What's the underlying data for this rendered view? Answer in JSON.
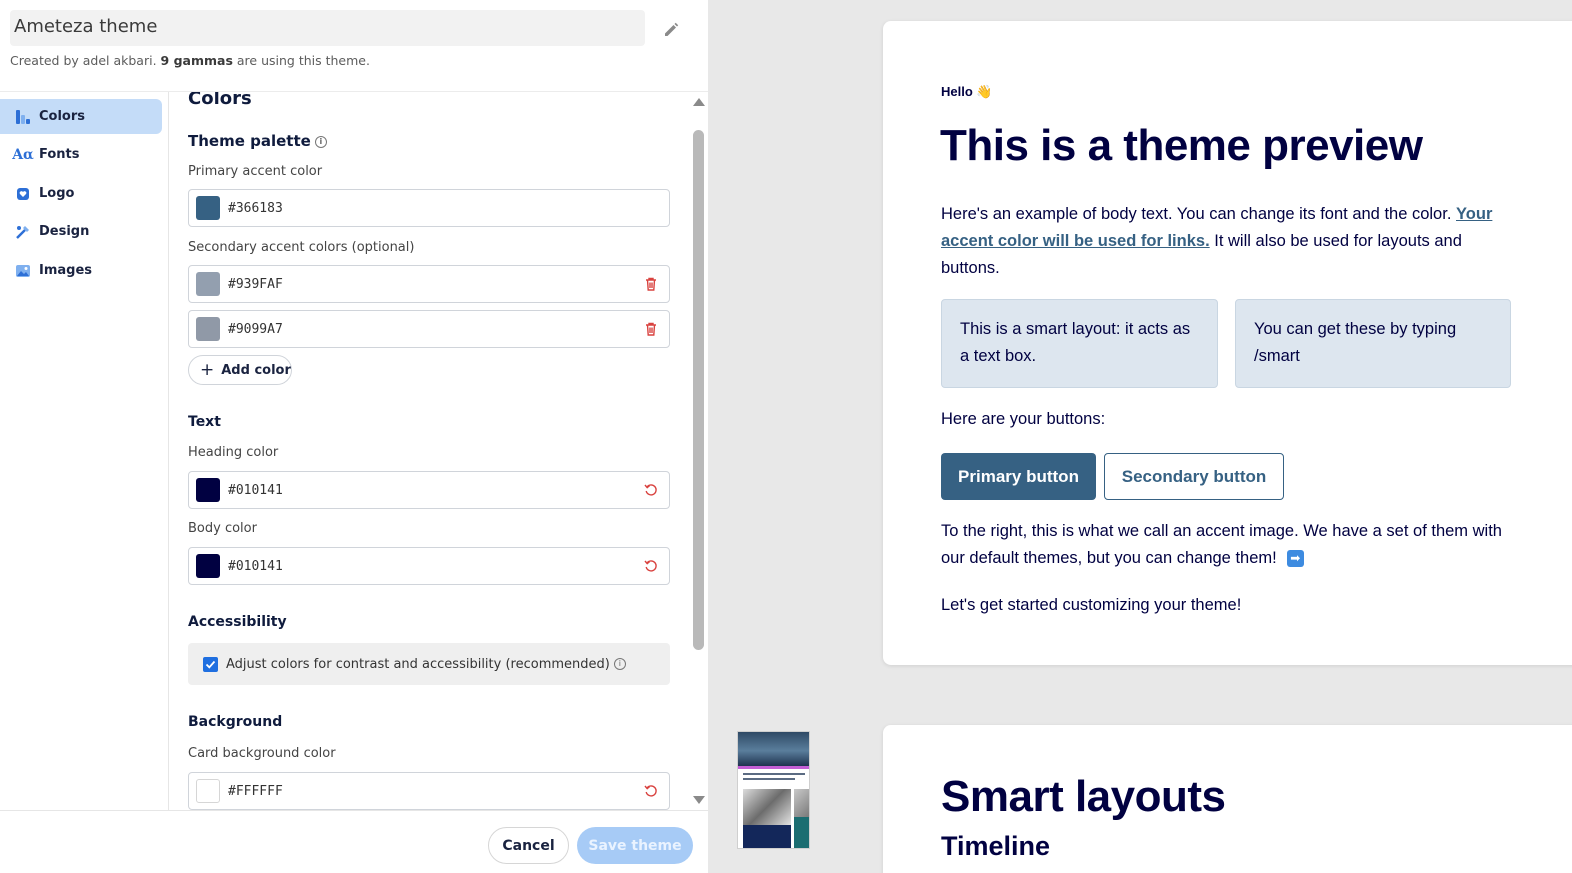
{
  "theme": {
    "name": "Ameteza theme",
    "created_prefix": "Created by adel akbari.",
    "gammas": "9 gammas",
    "created_suffix": "are using this theme."
  },
  "nav": {
    "items": [
      {
        "label": "Colors",
        "icon": "palette-icon"
      },
      {
        "label": "Fonts",
        "icon": "font-icon"
      },
      {
        "label": "Logo",
        "icon": "logo-icon"
      },
      {
        "label": "Design",
        "icon": "design-icon"
      },
      {
        "label": "Images",
        "icon": "image-icon"
      }
    ],
    "active": "Colors"
  },
  "colors": {
    "section_title": "Colors",
    "palette_title": "Theme palette",
    "primary_label": "Primary accent color",
    "primary": {
      "hex": "#366183",
      "swatch": "#366183"
    },
    "secondary_label": "Secondary accent colors (optional)",
    "secondary": [
      {
        "hex": "#939FAF",
        "swatch": "#939FAF"
      },
      {
        "hex": "#9099A7",
        "swatch": "#9099A7"
      }
    ],
    "add_color": "Add color",
    "text_title": "Text",
    "heading_label": "Heading color",
    "heading": {
      "hex": "#010141",
      "swatch": "#010141"
    },
    "body_label": "Body color",
    "body": {
      "hex": "#010141",
      "swatch": "#010141"
    },
    "access_title": "Accessibility",
    "access_checkbox": "Adjust colors for contrast and accessibility (recommended)",
    "access_checked": true,
    "bg_title": "Background",
    "card_bg_label": "Card background color",
    "card_bg": {
      "hex": "#FFFFFF",
      "swatch": "#FFFFFF"
    }
  },
  "footer": {
    "cancel": "Cancel",
    "save": "Save theme"
  },
  "preview": {
    "hello": "Hello 👋",
    "title": "This is a theme preview",
    "body_intro": "Here's an example of body text. You can change its font and the color.",
    "link_text": "Your accent color will be used for links.",
    "body_after_link": "It will also be used for layouts and buttons.",
    "smart1": "This is a smart layout: it acts as a text box.",
    "smart2": "You can get these by typing /smart",
    "buttons_intro": "Here are your buttons:",
    "primary_button": "Primary button",
    "secondary_button": "Secondary button",
    "accent_text": "To the right, this is what we call an accent image. We have a set of them with our default themes, but you can change them!",
    "arrow": "➡",
    "start_text": "Let's get started customizing your theme!",
    "card2_title": "Smart layouts",
    "card2_subtitle": "Timeline"
  },
  "theme_colors": {
    "accent": "#366183",
    "heading": "#010141",
    "nav_active_bg": "#c4dcf8",
    "save_disabled": "#a7cbf6",
    "danger_icon": "#d9423f"
  }
}
